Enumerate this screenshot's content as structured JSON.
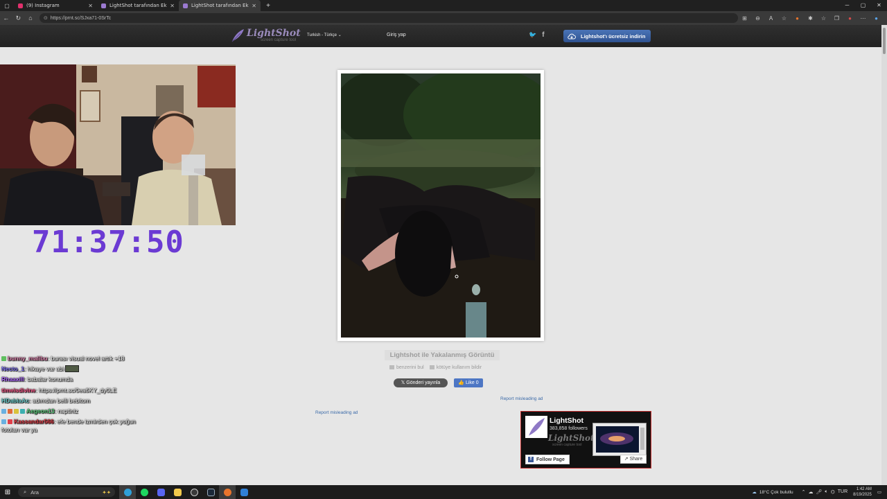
{
  "browser": {
    "tabs": [
      {
        "title": "(9) Instagram",
        "favicon_color": "#e1306c"
      },
      {
        "title": "LightShot tarafından Ekran Görüntüsü",
        "favicon_color": "#9b7ad0"
      },
      {
        "title": "LightShot tarafından Ekran Görüntüsü",
        "favicon_color": "#9b7ad0"
      }
    ],
    "url": "https://prnt.sc/SJxa71-0SrTc"
  },
  "header": {
    "logo_name": "LightShot",
    "logo_tagline": "screen capture tool",
    "language": "Turkish - Türkçe",
    "login": "Giriş yap",
    "download_button": "Lightshot'ı ücretsiz indirin"
  },
  "stream": {
    "timer": "71:37:50"
  },
  "screenshot": {
    "caption": "Lightshot ile Yakalanmış Görüntü",
    "find_similar": "benzerini bul",
    "report_abuse": "kötüye kullanım bildir",
    "tweet": "Gönderi yayınla",
    "like": "Like 0",
    "report_ad_1": "Report misleading ad",
    "report_ad_2": "Report misleading ad"
  },
  "fb_widget": {
    "name": "LightShot",
    "followers": "383,858 followers",
    "brand": "LightShot",
    "brand_sub": "screen capture tool",
    "follow": "Follow Page",
    "share": "Share"
  },
  "chat": [
    {
      "user": "bunny_malibu",
      "color": "#e58bb5",
      "badge": "#5fbf5f",
      "msg": ": burası visual novel artık +18"
    },
    {
      "user": "Necto_1",
      "color": "#8a7cff",
      "badge": "",
      "msg": ": hikaye var abi"
    },
    {
      "user": "Rhaaxill",
      "color": "#b06bff",
      "badge": "",
      "msg": ": babalar konumda"
    },
    {
      "user": "timeisdivine",
      "color": "#ff5d8f",
      "badge": "",
      "msg": ": https://prnt.sc/0ea6KY_dy0LE"
    },
    {
      "user": "HDabiaAc",
      "color": "#74d4d4",
      "badge": "",
      "msg": ": adımdan belli bebitom"
    },
    {
      "user": "Aegeon13",
      "color": "#5fcf7f",
      "badge": "#d9c23c",
      "msg": ": naptiniz"
    },
    {
      "user": "Kassandar566",
      "color": "#e0404a",
      "badge": "#5fa2e0",
      "msg": ": efe bende izmirden çok yoğun fotoları var ya"
    }
  ],
  "taskbar": {
    "search": "Ara",
    "weather": "18°C  Çok bulutlu",
    "lang": "TUR",
    "time": "1:42 AM",
    "date": "8/19/2025"
  }
}
